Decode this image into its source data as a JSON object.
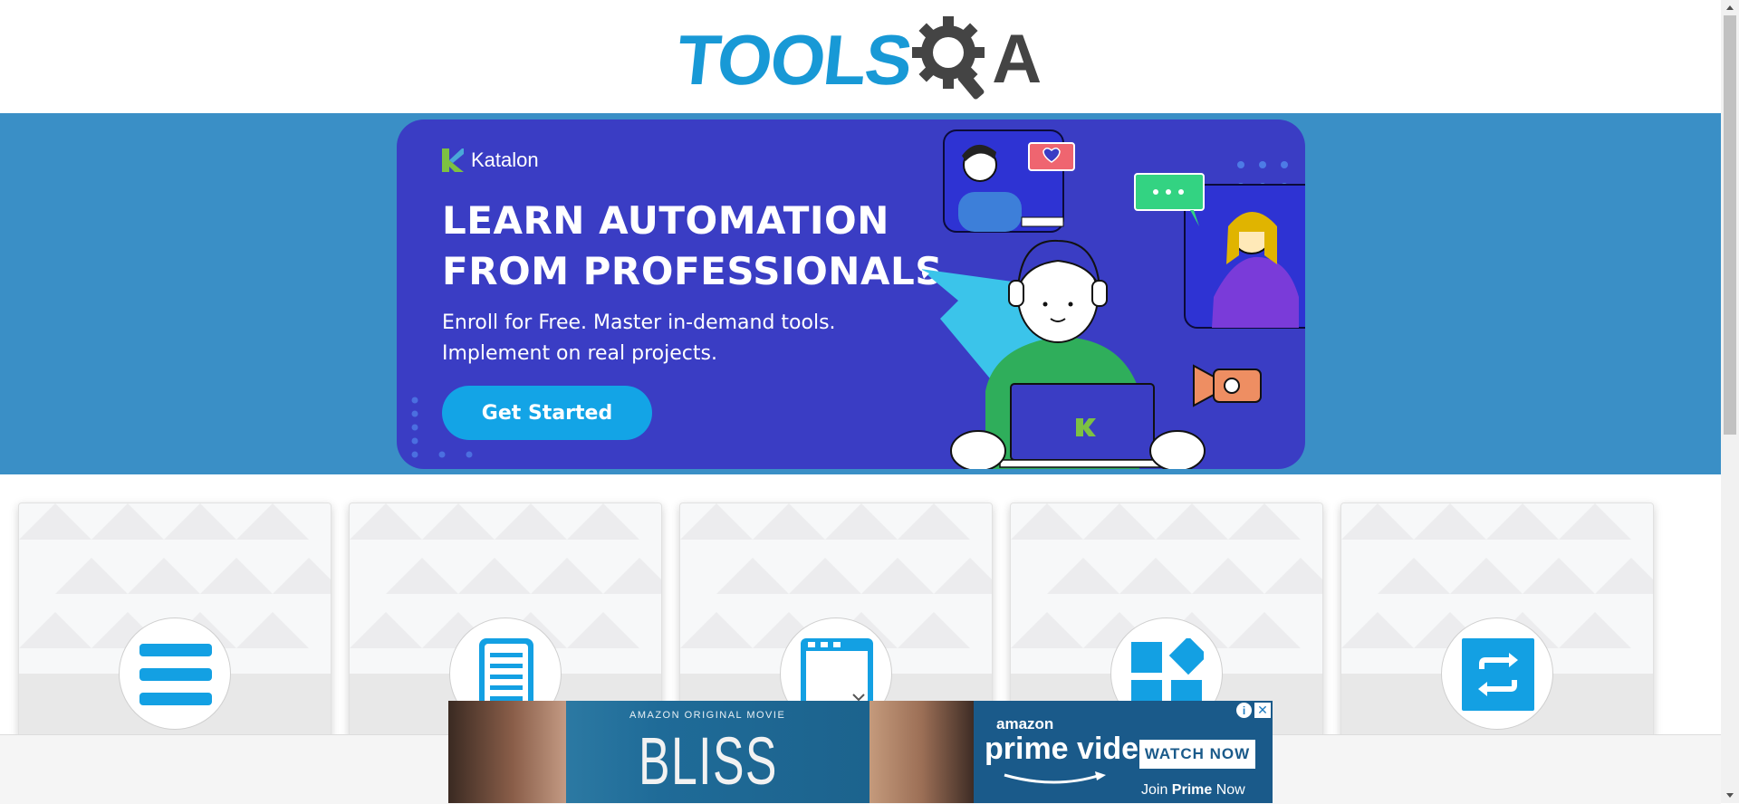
{
  "header": {
    "logo_tools": "TOOLS",
    "logo_a": "A"
  },
  "banner": {
    "brand": "Katalon",
    "headline_line1": "LEARN AUTOMATION",
    "headline_line2": "FROM PROFESSIONALS",
    "sub_line1": "Enroll for Free. Master in-demand tools.",
    "sub_line2": "Implement on real projects.",
    "cta_label": "Get Started",
    "colors": {
      "band": "#3a8fc6",
      "banner": "#3a3dc4",
      "cta": "#13a4e6"
    }
  },
  "cards": [
    {
      "icon": "menu-icon"
    },
    {
      "icon": "document-icon"
    },
    {
      "icon": "browser-window-icon"
    },
    {
      "icon": "widgets-icon"
    },
    {
      "icon": "interactions-icon"
    }
  ],
  "ad": {
    "tag": "AMAZON ORIGINAL MOVIE",
    "title": "BLISS",
    "amazon": "amazon",
    "prime": "prime video",
    "watch_label": "WATCH NOW",
    "join_prefix": "Join ",
    "join_bold": "Prime",
    "join_suffix": " Now",
    "info_icon": "i",
    "close_icon": "✕"
  }
}
